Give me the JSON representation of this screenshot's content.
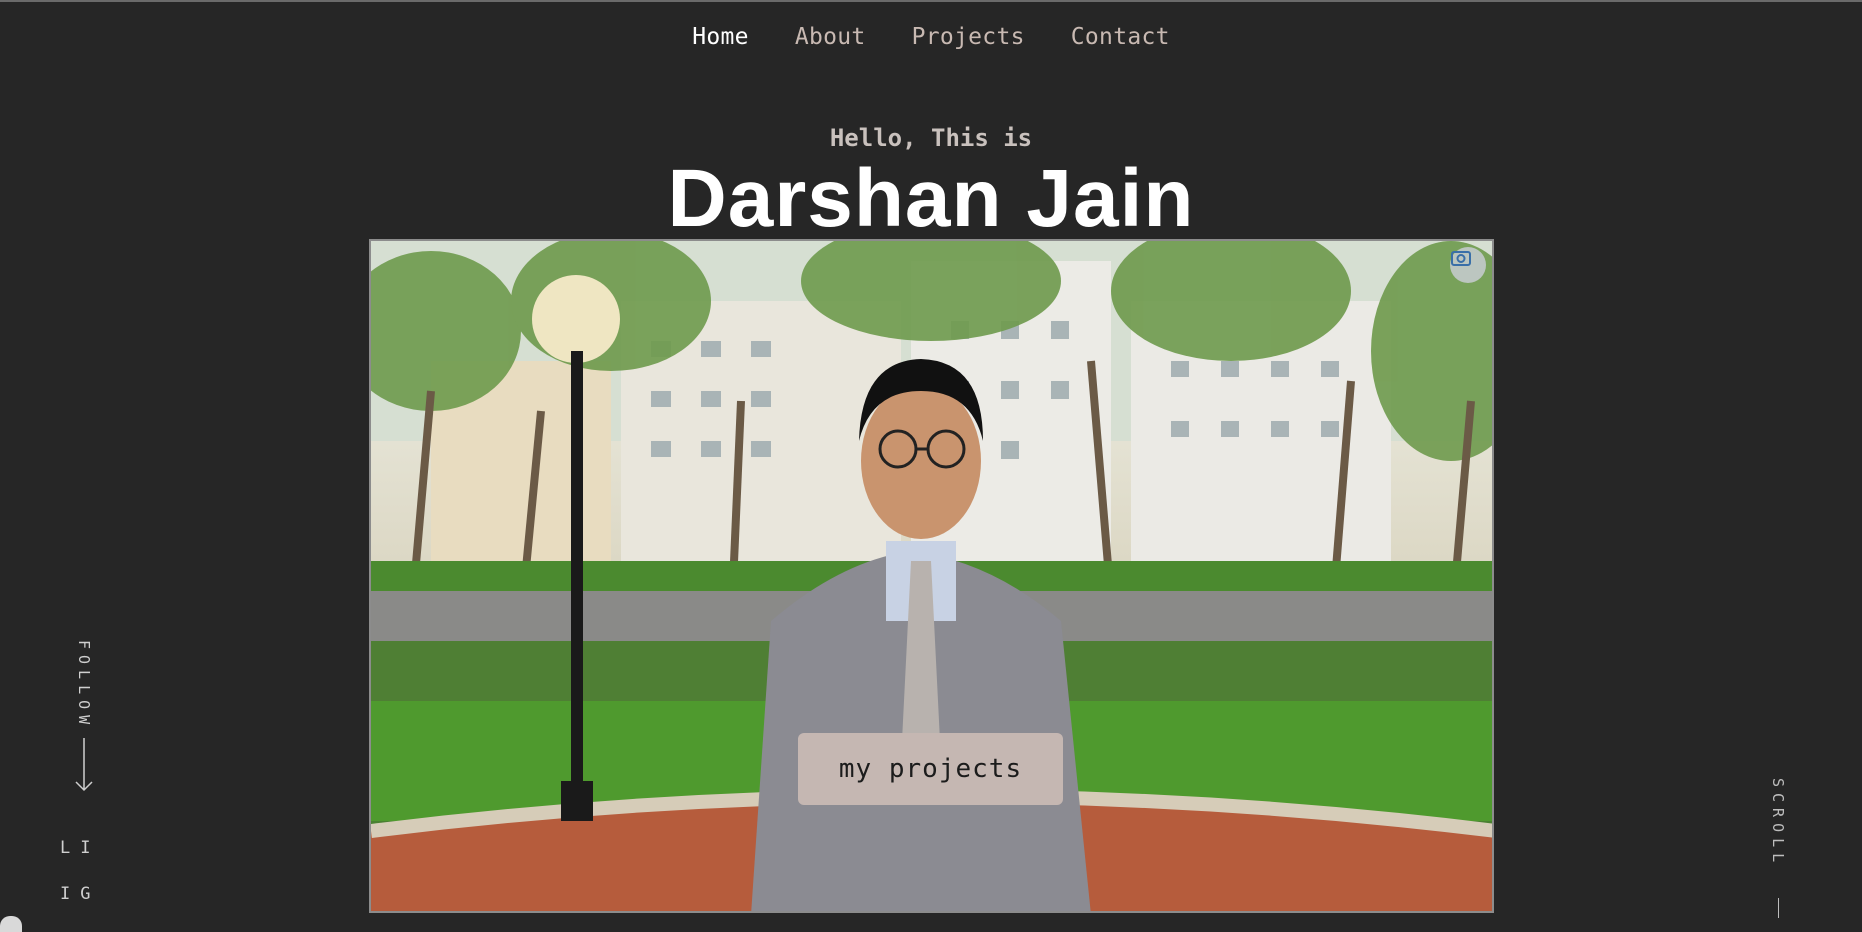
{
  "nav": {
    "items": [
      {
        "label": "Home",
        "active": true
      },
      {
        "label": "About",
        "active": false
      },
      {
        "label": "Projects",
        "active": false
      },
      {
        "label": "Contact",
        "active": false
      }
    ]
  },
  "hero": {
    "greeting": "Hello, This is",
    "name": "Darshan Jain",
    "cta_label": "my projects"
  },
  "sidebar_left": {
    "follow_label": "FOLLOW",
    "links": [
      {
        "label": "LI"
      },
      {
        "label": "IG"
      }
    ]
  },
  "sidebar_right": {
    "scroll_label": "SCROLL"
  },
  "colors": {
    "background": "#262626",
    "accent_button": "#c5b7b2",
    "nav_inactive": "#c8b9b2"
  },
  "icons": {
    "camera": "camera-icon",
    "arrow": "arrow-down-icon"
  }
}
